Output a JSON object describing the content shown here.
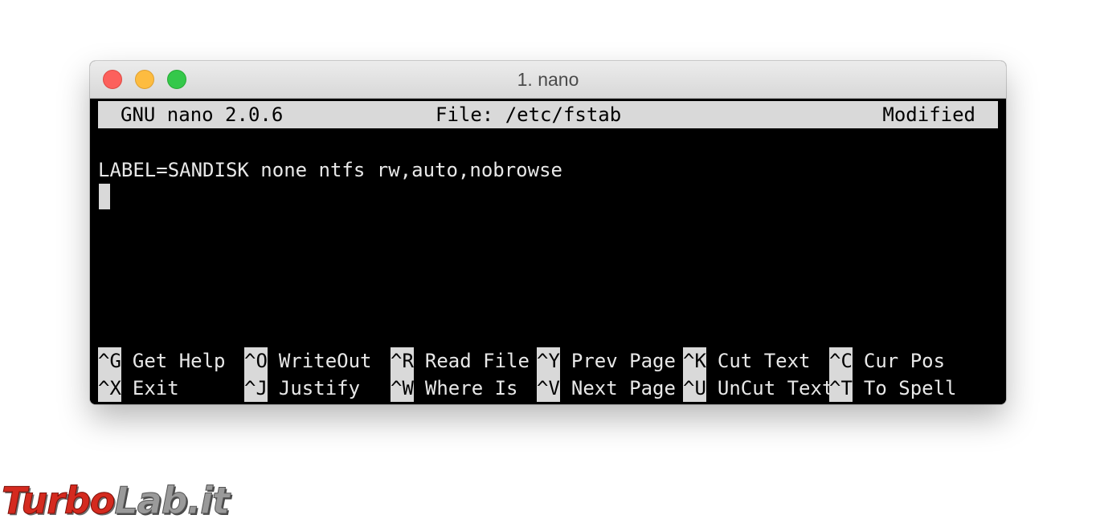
{
  "window": {
    "title": "1. nano"
  },
  "nano": {
    "header": {
      "version": "GNU nano 2.0.6",
      "file": "File: /etc/fstab",
      "status": "Modified"
    },
    "content_lines": [
      "LABEL=SANDISK none ntfs rw,auto,nobrowse"
    ],
    "shortcuts_row1": [
      {
        "key": "^G",
        "label": "Get Help"
      },
      {
        "key": "^O",
        "label": "WriteOut"
      },
      {
        "key": "^R",
        "label": "Read File"
      },
      {
        "key": "^Y",
        "label": "Prev Page"
      },
      {
        "key": "^K",
        "label": "Cut Text"
      },
      {
        "key": "^C",
        "label": "Cur Pos"
      }
    ],
    "shortcuts_row2": [
      {
        "key": "^X",
        "label": "Exit"
      },
      {
        "key": "^J",
        "label": "Justify"
      },
      {
        "key": "^W",
        "label": "Where Is"
      },
      {
        "key": "^V",
        "label": "Next Page"
      },
      {
        "key": "^U",
        "label": "UnCut Text"
      },
      {
        "key": "^T",
        "label": "To Spell"
      }
    ]
  },
  "watermark": {
    "part1": "Turbo",
    "part2": "Lab.it"
  },
  "colors": {
    "terminal_background": "#000000",
    "header_bar": "#d9d9d9",
    "close_button": "#fc605c",
    "minimize_button": "#fdbc40",
    "zoom_button": "#34c84a",
    "watermark_red": "#d42a1f"
  }
}
